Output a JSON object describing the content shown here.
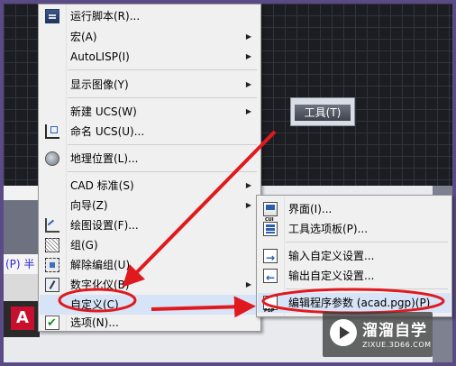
{
  "command_line_text": "(P) 半",
  "app_logo_letter": "A",
  "canvas_tool_label": "工具(T)",
  "main_menu": {
    "items": [
      {
        "label": "运行脚本(R)...",
        "icon": "script-icon",
        "submenu": false
      },
      {
        "label": "宏(A)",
        "icon": "",
        "submenu": true
      },
      {
        "label": "AutoLISP(I)",
        "icon": "",
        "submenu": true
      },
      {
        "label": "显示图像(Y)",
        "icon": "",
        "submenu": true
      },
      {
        "label": "新建 UCS(W)",
        "icon": "",
        "submenu": true
      },
      {
        "label": "命名 UCS(U)...",
        "icon": "ucs-icon",
        "submenu": false
      },
      {
        "label": "地理位置(L)...",
        "icon": "globe-icon",
        "submenu": false
      },
      {
        "label": "CAD 标准(S)",
        "icon": "",
        "submenu": true
      },
      {
        "label": "向导(Z)",
        "icon": "",
        "submenu": true
      },
      {
        "label": "绘图设置(F)...",
        "icon": "drafting-settings-icon",
        "submenu": false
      },
      {
        "label": "组(G)",
        "icon": "group-icon",
        "submenu": false
      },
      {
        "label": "解除编组(U)",
        "icon": "ungroup-icon",
        "submenu": false
      },
      {
        "label": "数字化仪(B)",
        "icon": "",
        "submenu": true
      },
      {
        "label": "自定义(C)",
        "icon": "",
        "submenu": true
      },
      {
        "label": "选项(N)...",
        "icon": "checkbox-icon",
        "submenu": false
      }
    ]
  },
  "sub_menu": {
    "items": [
      {
        "label": "界面(I)...",
        "icon": "cui-icon"
      },
      {
        "label": "工具选项板(P)...",
        "icon": "tool-palette-icon"
      },
      {
        "label": "输入自定义设置...",
        "icon": "import-icon"
      },
      {
        "label": "输出自定义设置...",
        "icon": "export-icon"
      },
      {
        "label": "编辑程序参数 (acad.pgp)(P)",
        "icon": "pgp-icon"
      }
    ]
  },
  "annotation_color": "#e0191e",
  "highlight_color": "#d7e3f6",
  "watermark": {
    "title": "溜溜自学",
    "url": "ZIXUE.3D66.COM"
  }
}
